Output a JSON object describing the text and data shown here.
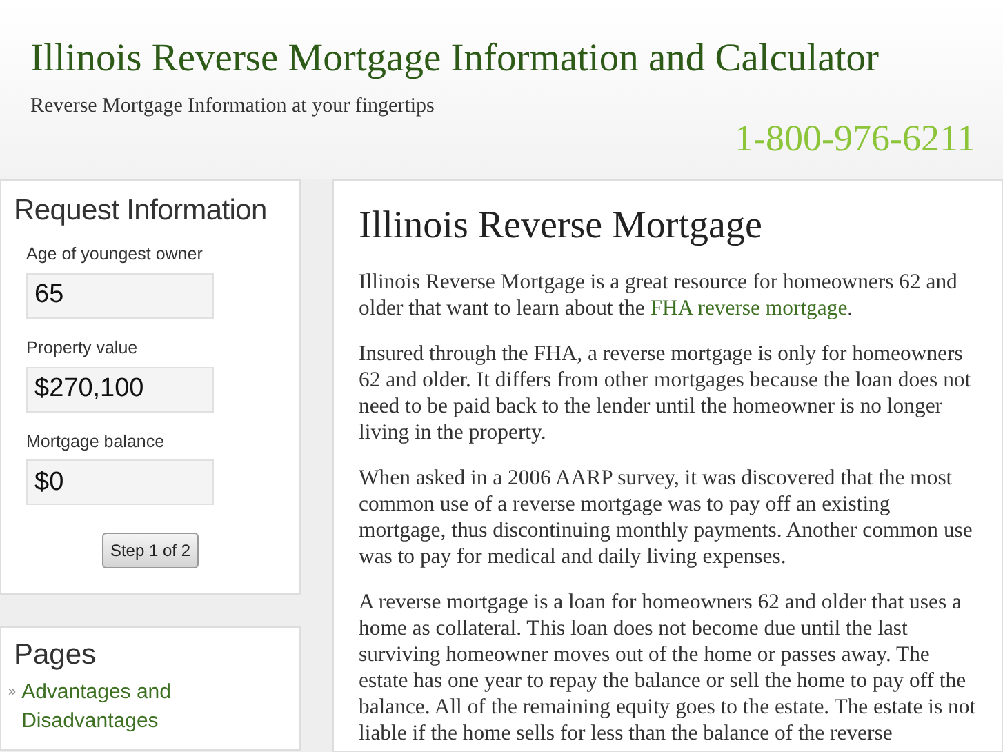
{
  "header": {
    "title": "Illinois Reverse Mortgage Information and Calculator",
    "tagline": "Reverse Mortgage Information at your fingertips",
    "phone": "1-800-976-6211"
  },
  "request_form": {
    "title": "Request Information",
    "fields": [
      {
        "label": "Age of youngest owner",
        "value": "65"
      },
      {
        "label": "Property value",
        "value": "$270,100"
      },
      {
        "label": "Mortgage balance",
        "value": "$0"
      }
    ],
    "button": "Step 1 of 2"
  },
  "pages": {
    "title": "Pages",
    "items": [
      {
        "bullet": "»",
        "label": "Advantages and Disadvantages"
      }
    ]
  },
  "article": {
    "title": "Illinois Reverse Mortgage",
    "paragraphs": [
      {
        "before": "Illinois Reverse Mortgage is a great resource for homeowners 62 and older that want to learn about the ",
        "link": "FHA reverse mortgage",
        "after": "."
      },
      {
        "before": "Insured through the FHA, a reverse mortgage is only for homeowners 62 and older. It differs from other mortgages because the loan does not need to be paid back to the lender until the homeowner is no longer living in the property."
      },
      {
        "before": "When asked in a 2006 AARP survey, it was discovered that the most common use of a reverse mortgage was to pay off an existing mortgage, thus discontinuing monthly payments. Another common use was to pay for medical and daily living expenses."
      },
      {
        "before": "A reverse mortgage is a loan for homeowners 62 and older that uses a home as collateral. This loan does not become due until the last surviving homeowner moves out of the home or passes away. The estate has one year to repay the balance or sell the home to pay off the balance. All of the remaining equity goes to the estate. The estate is not liable if the home sells for less than the balance of the reverse"
      }
    ]
  }
}
